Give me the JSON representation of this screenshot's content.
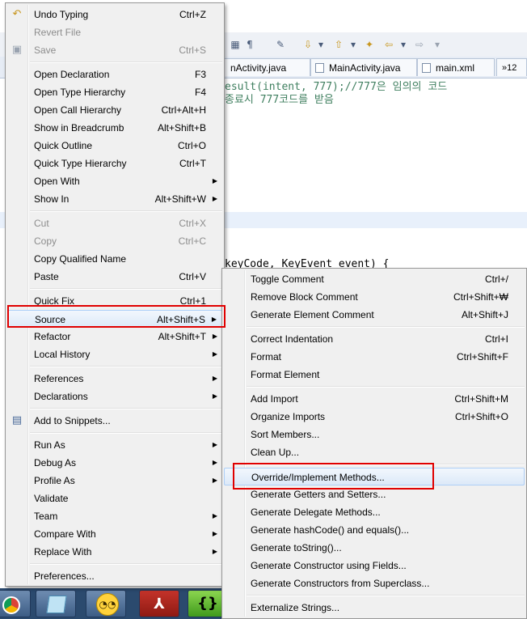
{
  "background": {
    "tabs": [
      "nActivity.java",
      "MainActivity.java",
      "main.xml"
    ],
    "tab_overflow": "»12",
    "code_lines": [
      "esult(intent, 777);//777은 임의의 코드",
      "종료시 777코드를 받음",
      "keyCode, KeyEvent event) {"
    ],
    "taskbar_icons": [
      "chrome-icon",
      "notepad-icon",
      "messenger-icon",
      "acrobat-icon",
      "eclipse-icon"
    ]
  },
  "context_menu": {
    "items": [
      {
        "label": "Undo Typing",
        "shortcut": "Ctrl+Z",
        "icon": "undo-icon"
      },
      {
        "label": "Revert File",
        "shortcut": "",
        "disabled": true
      },
      {
        "label": "Save",
        "shortcut": "Ctrl+S",
        "disabled": true,
        "icon": "save-icon"
      },
      {
        "label": "Open Declaration",
        "shortcut": "F3"
      },
      {
        "label": "Open Type Hierarchy",
        "shortcut": "F4"
      },
      {
        "label": "Open Call Hierarchy",
        "shortcut": "Ctrl+Alt+H"
      },
      {
        "label": "Show in Breadcrumb",
        "shortcut": "Alt+Shift+B"
      },
      {
        "label": "Quick Outline",
        "shortcut": "Ctrl+O"
      },
      {
        "label": "Quick Type Hierarchy",
        "shortcut": "Ctrl+T"
      },
      {
        "label": "Open With",
        "shortcut": "",
        "submenu": true
      },
      {
        "label": "Show In",
        "shortcut": "Alt+Shift+W",
        "submenu": true
      },
      {
        "label": "Cut",
        "shortcut": "Ctrl+X",
        "disabled": true
      },
      {
        "label": "Copy",
        "shortcut": "Ctrl+C",
        "disabled": true
      },
      {
        "label": "Copy Qualified Name",
        "shortcut": ""
      },
      {
        "label": "Paste",
        "shortcut": "Ctrl+V"
      },
      {
        "label": "Quick Fix",
        "shortcut": "Ctrl+1"
      },
      {
        "label": "Source",
        "shortcut": "Alt+Shift+S",
        "submenu": true,
        "highlighted": true
      },
      {
        "label": "Refactor",
        "shortcut": "Alt+Shift+T",
        "submenu": true
      },
      {
        "label": "Local History",
        "shortcut": "",
        "submenu": true
      },
      {
        "label": "References",
        "shortcut": "",
        "submenu": true
      },
      {
        "label": "Declarations",
        "shortcut": "",
        "submenu": true
      },
      {
        "label": "Add to Snippets...",
        "shortcut": "",
        "icon": "snippet-icon"
      },
      {
        "label": "Run As",
        "shortcut": "",
        "submenu": true
      },
      {
        "label": "Debug As",
        "shortcut": "",
        "submenu": true
      },
      {
        "label": "Profile As",
        "shortcut": "",
        "submenu": true
      },
      {
        "label": "Validate",
        "shortcut": ""
      },
      {
        "label": "Team",
        "shortcut": "",
        "submenu": true
      },
      {
        "label": "Compare With",
        "shortcut": "",
        "submenu": true
      },
      {
        "label": "Replace With",
        "shortcut": "",
        "submenu": true
      },
      {
        "label": "Preferences...",
        "shortcut": ""
      }
    ]
  },
  "source_submenu": {
    "items": [
      {
        "label": "Toggle Comment",
        "shortcut": "Ctrl+/"
      },
      {
        "label": "Remove Block Comment",
        "shortcut": "Ctrl+Shift+₩"
      },
      {
        "label": "Generate Element Comment",
        "shortcut": "Alt+Shift+J"
      },
      {
        "label": "Correct Indentation",
        "shortcut": "Ctrl+I"
      },
      {
        "label": "Format",
        "shortcut": "Ctrl+Shift+F"
      },
      {
        "label": "Format Element",
        "shortcut": ""
      },
      {
        "label": "Add Import",
        "shortcut": "Ctrl+Shift+M"
      },
      {
        "label": "Organize Imports",
        "shortcut": "Ctrl+Shift+O"
      },
      {
        "label": "Sort Members...",
        "shortcut": ""
      },
      {
        "label": "Clean Up...",
        "shortcut": ""
      },
      {
        "label": "Override/Implement Methods...",
        "shortcut": "",
        "highlighted": true
      },
      {
        "label": "Generate Getters and Setters...",
        "shortcut": ""
      },
      {
        "label": "Generate Delegate Methods...",
        "shortcut": ""
      },
      {
        "label": "Generate hashCode() and equals()...",
        "shortcut": ""
      },
      {
        "label": "Generate toString()...",
        "shortcut": ""
      },
      {
        "label": "Generate Constructor using Fields...",
        "shortcut": ""
      },
      {
        "label": "Generate Constructors from Superclass...",
        "shortcut": ""
      },
      {
        "label": "Externalize Strings...",
        "shortcut": ""
      }
    ]
  },
  "colors": {
    "highlight_box": "#e00000",
    "selection": "#dce9f8"
  }
}
